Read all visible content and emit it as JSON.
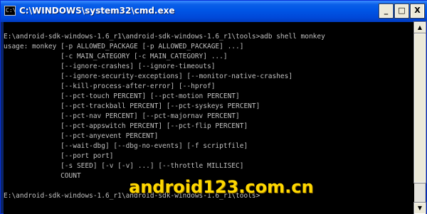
{
  "window": {
    "title": "C:\\WINDOWS\\system32\\cmd.exe",
    "icon_label": "C:\\",
    "buttons": {
      "minimize": "_",
      "maximize": "□",
      "close": "X"
    }
  },
  "console": {
    "lines": [
      "",
      "E:\\android-sdk-windows-1.6_r1\\android-sdk-windows-1.6_r1\\tools>adb shell monkey",
      "usage: monkey [-p ALLOWED_PACKAGE [-p ALLOWED_PACKAGE] ...]",
      "              [-c MAIN_CATEGORY [-c MAIN_CATEGORY] ...]",
      "              [--ignore-crashes] [--ignore-timeouts]",
      "              [--ignore-security-exceptions] [--monitor-native-crashes]",
      "              [--kill-process-after-error] [--hprof]",
      "              [--pct-touch PERCENT] [--pct-motion PERCENT]",
      "              [--pct-trackball PERCENT] [--pct-syskeys PERCENT]",
      "              [--pct-nav PERCENT] [--pct-majornav PERCENT]",
      "              [--pct-appswitch PERCENT] [--pct-flip PERCENT]",
      "              [--pct-anyevent PERCENT]",
      "              [--wait-dbg] [--dbg-no-events] [-f scriptfile]",
      "              [--port port]",
      "              [-s SEED] [-v [-v] ...] [--throttle MILLISEC]",
      "              COUNT",
      "",
      "E:\\android-sdk-windows-1.6_r1\\android-sdk-windows-1.6_r1\\tools>"
    ]
  },
  "scrollbar": {
    "up_arrow": "▲",
    "down_arrow": "▼"
  },
  "watermark": "android123.com.cn"
}
